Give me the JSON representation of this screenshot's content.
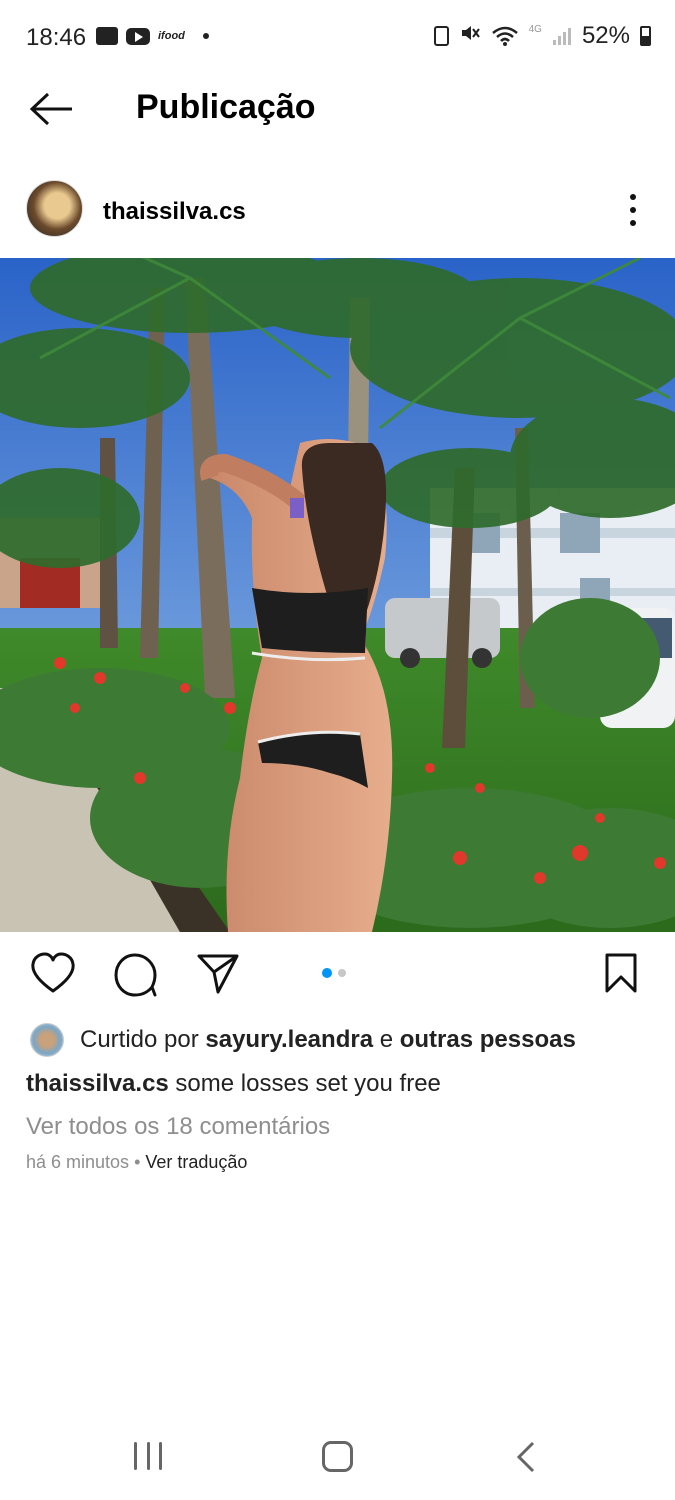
{
  "status_bar": {
    "time": "18:46",
    "left_icons": [
      "gallery-icon",
      "youtube-icon",
      "ifood-icon",
      "dot"
    ],
    "ifood_text": "ifood",
    "network": "4G",
    "battery_text": "52%",
    "battery_percent": 52
  },
  "header": {
    "title": "Publicação"
  },
  "post": {
    "username": "thaissilva.cs",
    "photo_alt": "",
    "carousel": {
      "pages": 2,
      "active_index": 0,
      "active_color": "#0095f6",
      "inactive_color": "#c7c7c7"
    },
    "likes": {
      "prefix": "Curtido por ",
      "user": "sayury.leandra",
      "conjunction": " e ",
      "others": "outras pessoas"
    },
    "caption": {
      "username": "thaissilva.cs",
      "text": " some losses set you free"
    },
    "view_comments": "Ver todos os 18 comentários",
    "time_ago": "há 6 minutos",
    "separator": " • ",
    "translate": "Ver tradução"
  },
  "icons": {
    "back": "arrow-left-icon",
    "more": "more-vertical-icon",
    "like": "heart-icon",
    "comment": "comment-icon",
    "share": "send-icon",
    "save": "bookmark-icon"
  },
  "colors": {
    "accent": "#0095f6",
    "text": "#222222",
    "secondary_text": "#8e8e8e"
  }
}
